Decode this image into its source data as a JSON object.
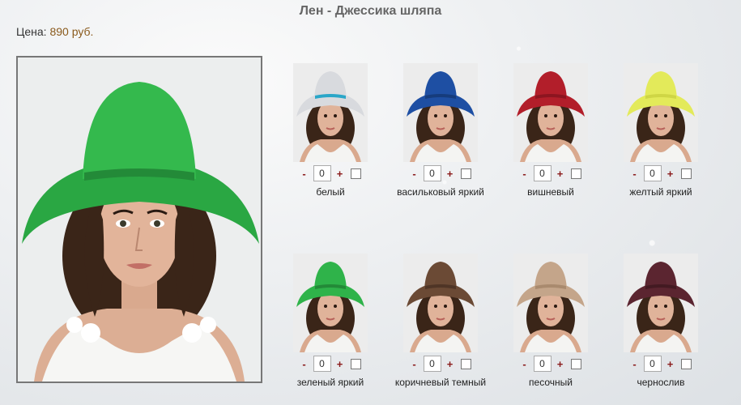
{
  "product": {
    "title": "Лен - Джессика шляпа",
    "price_label": "Цена: ",
    "price_value": "890 руб."
  },
  "main_image": {
    "hat_color": "#2fb34a",
    "name": "зеленый яркий"
  },
  "variants": [
    {
      "name": "белый",
      "hat_color": "#d8dade",
      "band_color": "#2aa6c8",
      "qty": "0"
    },
    {
      "name": "васильковый яркий",
      "hat_color": "#1e4fa3",
      "band_color": "#163c7c",
      "qty": "0"
    },
    {
      "name": "вишневый",
      "hat_color": "#b21e2a",
      "band_color": "#8c1520",
      "qty": "0"
    },
    {
      "name": "желтый яркий",
      "hat_color": "#e3ea5a",
      "band_color": "#cfd645",
      "qty": "0"
    },
    {
      "name": "зеленый яркий",
      "hat_color": "#2fb34a",
      "band_color": "#238a38",
      "qty": "0"
    },
    {
      "name": "коричневый темный",
      "hat_color": "#6b4a35",
      "band_color": "#4f3526",
      "qty": "0"
    },
    {
      "name": "песочный",
      "hat_color": "#c4a58a",
      "band_color": "#a98a6e",
      "qty": "0"
    },
    {
      "name": "чернослив",
      "hat_color": "#5b2530",
      "band_color": "#431a22",
      "qty": "0"
    }
  ],
  "controls": {
    "minus": "-",
    "plus": "+"
  }
}
